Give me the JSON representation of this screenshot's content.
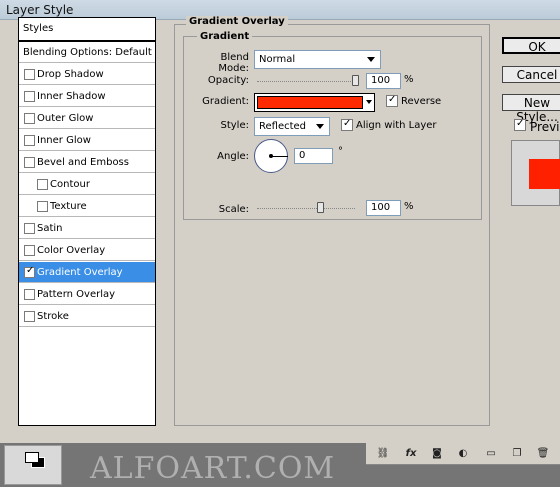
{
  "window": {
    "title": "Layer Style"
  },
  "styles_panel": {
    "header": "Styles",
    "items": [
      {
        "label": "Blending Options: Default",
        "checkbox": false,
        "checked": false,
        "selected": false,
        "indent": false
      },
      {
        "label": "Drop Shadow",
        "checkbox": true,
        "checked": false,
        "selected": false,
        "indent": false
      },
      {
        "label": "Inner Shadow",
        "checkbox": true,
        "checked": false,
        "selected": false,
        "indent": false
      },
      {
        "label": "Outer Glow",
        "checkbox": true,
        "checked": false,
        "selected": false,
        "indent": false
      },
      {
        "label": "Inner Glow",
        "checkbox": true,
        "checked": false,
        "selected": false,
        "indent": false
      },
      {
        "label": "Bevel and Emboss",
        "checkbox": true,
        "checked": false,
        "selected": false,
        "indent": false
      },
      {
        "label": "Contour",
        "checkbox": true,
        "checked": false,
        "selected": false,
        "indent": true
      },
      {
        "label": "Texture",
        "checkbox": true,
        "checked": false,
        "selected": false,
        "indent": true
      },
      {
        "label": "Satin",
        "checkbox": true,
        "checked": false,
        "selected": false,
        "indent": false
      },
      {
        "label": "Color Overlay",
        "checkbox": true,
        "checked": false,
        "selected": false,
        "indent": false
      },
      {
        "label": "Gradient Overlay",
        "checkbox": true,
        "checked": true,
        "selected": true,
        "indent": false
      },
      {
        "label": "Pattern Overlay",
        "checkbox": true,
        "checked": false,
        "selected": false,
        "indent": false
      },
      {
        "label": "Stroke",
        "checkbox": true,
        "checked": false,
        "selected": false,
        "indent": false
      }
    ]
  },
  "gradient_overlay": {
    "group_title": "Gradient Overlay",
    "sub_title": "Gradient",
    "blend_mode": {
      "label": "Blend Mode:",
      "value": "Normal"
    },
    "opacity": {
      "label": "Opacity:",
      "value": "100",
      "unit": "%",
      "fraction": 1.0
    },
    "gradient": {
      "label": "Gradient:",
      "color": "#ff2a00"
    },
    "reverse": {
      "label": "Reverse",
      "checked": true
    },
    "style": {
      "label": "Style:",
      "value": "Reflected"
    },
    "align_with_layer": {
      "label": "Align with Layer",
      "checked": true
    },
    "angle": {
      "label": "Angle:",
      "value": "0",
      "unit": "°"
    },
    "scale": {
      "label": "Scale:",
      "value": "100",
      "unit": "%",
      "fraction": 0.64
    }
  },
  "buttons": {
    "ok": "OK",
    "cancel": "Cancel",
    "new_style": "New Style...",
    "preview_label": "Preview",
    "preview_checked": true
  },
  "bottom": {
    "watermark": "ALFOART.COM",
    "icons": [
      "link-icon",
      "fx-icon",
      "mask-icon",
      "adjustment-icon",
      "folder-icon",
      "new-layer-icon",
      "trash-icon"
    ]
  }
}
